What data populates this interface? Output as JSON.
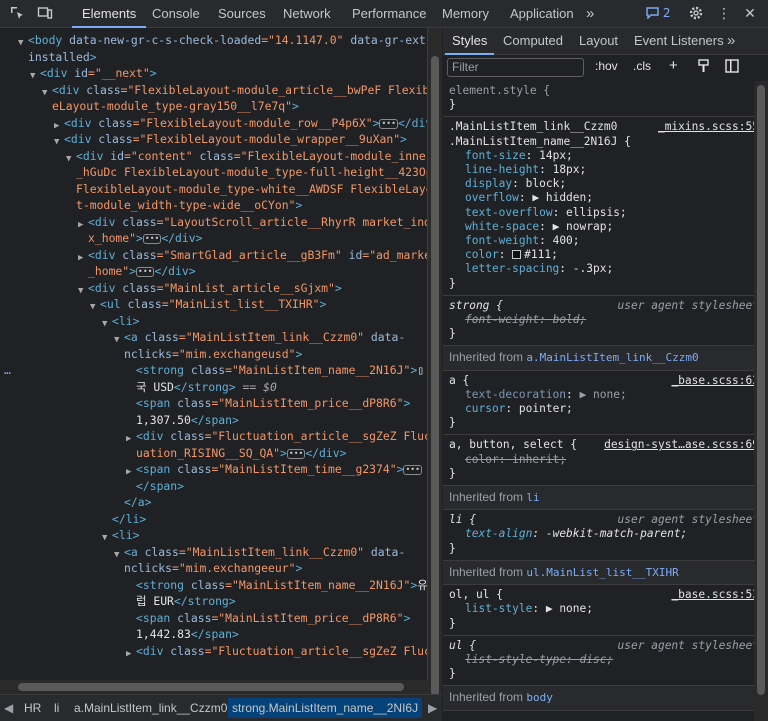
{
  "toolbar": {
    "tabs": [
      "Elements",
      "Console",
      "Sources",
      "Network",
      "Performance",
      "Memory",
      "Application"
    ],
    "active_tab": "Elements",
    "more": "»",
    "issues_count": "2",
    "icons": [
      "inspect-icon",
      "device-toggle-icon",
      "more-tabs-icon",
      "issues-icon",
      "gear-icon",
      "kebab-menu-icon",
      "close-icon"
    ]
  },
  "dom": {
    "selected_marker": "…",
    "lines": [
      [
        "<body ",
        "data-new-gr-c-s-check-loaded",
        "=\"14.1147.0\" ",
        "data-gr-ext-"
      ],
      [
        "installed",
        ">"
      ],
      [
        "<div ",
        "id",
        "=\"__next\"",
        ">"
      ],
      [
        "<div ",
        "class",
        "=\"FlexibleLayout-module_article__bwPeF Flexibl"
      ],
      [
        "eLayout-module_type-gray150__l7e7q\"",
        ">"
      ],
      [
        "<div ",
        "class",
        "=\"FlexibleLayout-module_row__P4p6X\"",
        ">",
        "</div>"
      ],
      [
        "<div ",
        "class",
        "=\"FlexibleLayout-module_wrapper__9uXan\"",
        ">"
      ],
      [
        "<div ",
        "id",
        "=\"content\" ",
        "class",
        "=\"FlexibleLayout-module_inner_"
      ],
      [
        "_hGuDc FlexibleLayout-module_type-full-height__423Op"
      ],
      [
        "FlexibleLayout-module_type-white__AWDSF FlexibleLayou"
      ],
      [
        "t-module_width-type-wide__oCYon\"",
        ">"
      ],
      [
        "<div ",
        "class",
        "=\"LayoutScroll_article__RhyrR market_inde"
      ],
      [
        "x_home\"",
        ">",
        "</div>"
      ],
      [
        "<div ",
        "class",
        "=\"SmartGlad_article__gB3Fm\" ",
        "id",
        "=\"ad_market"
      ],
      [
        "_home\"",
        ">",
        "</div>"
      ],
      [
        "<div ",
        "class",
        "=\"MainList_article__sGjxm\"",
        ">"
      ],
      [
        "<ul ",
        "class",
        "=\"MainList_list__TXIHR\"",
        ">"
      ],
      [
        "<li>"
      ],
      [
        "<a ",
        "class",
        "=\"MainListItem_link__Czzm0\" ",
        "data-"
      ],
      [
        "nclicks",
        "=\"mim.exchangeusd\"",
        ">"
      ],
      [
        "<strong ",
        "class",
        "=\"MainListItem_name__2N16J\"",
        ">"
      ],
      [
        "국 ",
        "USD",
        "</strong>",
        " == $0"
      ],
      [
        "<span ",
        "class",
        "=\"MainListItem_price__dP8R6\"",
        ">"
      ],
      [
        "1,307.50",
        "</span>"
      ],
      [
        "<div ",
        "class",
        "=\"Fluctuation_article__sgZeZ Fluct"
      ],
      [
        "uation_RISING__SQ_QA\"",
        ">",
        "</div>"
      ],
      [
        "<span ",
        "class",
        "=\"MainListItem_time__g2374\"",
        ">"
      ],
      [
        "</span>"
      ],
      [
        "</a>"
      ],
      [
        "</li>"
      ],
      [
        "<li>"
      ],
      [
        "<a ",
        "class",
        "=\"MainListItem_link__Czzm0\" ",
        "data-"
      ],
      [
        "nclicks",
        "=\"mim.exchangeeur\"",
        ">"
      ],
      [
        "<strong ",
        "class",
        "=\"MainListItem_name__2N16J\"",
        ">"
      ],
      [
        "럽 ",
        "EUR",
        "</strong>"
      ],
      [
        "<span ",
        "class",
        "=\"MainListItem_price__dP8R6\"",
        ">"
      ],
      [
        "1,442.83",
        "</span>"
      ],
      [
        "<div ",
        "class",
        "=\"Fluctuation_article__sgZeZ Fluct"
      ]
    ]
  },
  "breadcrumbs": {
    "items": [
      "HR",
      "li",
      "a.MainListItem_link__Czzm0",
      "strong.MainListItem_name__2NI6J"
    ],
    "current": "strong.MainListItem_name__2NI6J"
  },
  "styles_panel": {
    "tabs": [
      "Styles",
      "Computed",
      "Layout",
      "Event Listeners"
    ],
    "active_tab": "Styles",
    "more": "»",
    "filter_placeholder": "Filter",
    "hov": ":hov",
    "cls": ".cls",
    "rules": {
      "element_style": "element.style {",
      "r1_sel1": ".MainListItem_link__Czzm0",
      "r1_sel2": ".MainListItem_name__2N16J {",
      "r1_src": "_mixins.scss:55",
      "r1_props": [
        [
          "font-size",
          "14px;"
        ],
        [
          "line-height",
          "18px;"
        ],
        [
          "display",
          "block;"
        ],
        [
          "overflow",
          "▶ hidden;"
        ],
        [
          "text-overflow",
          "ellipsis;"
        ],
        [
          "white-space",
          "▶ nowrap;"
        ],
        [
          "font-weight",
          "400;"
        ],
        [
          "color",
          "#111;"
        ],
        [
          "letter-spacing",
          "-.3px;"
        ]
      ],
      "r2_sel": "strong {",
      "r2_src": "user agent stylesheet",
      "r2_prop": [
        "font-weight",
        "bold;"
      ],
      "inh1_label": "Inherited from",
      "inh1_link": "a.MainListItem_link__Czzm0",
      "r3_sel": "a {",
      "r3_src": "_base.scss:63",
      "r3_props": [
        [
          "text-decoration",
          "▶ none;"
        ],
        [
          "cursor",
          "pointer;"
        ]
      ],
      "r4_sel": "a, button, select {",
      "r4_src": "design-syst…ase.scss:69",
      "r4_prop": [
        "color",
        "inherit;"
      ],
      "inh2_label": "Inherited from",
      "inh2_link": "li",
      "r5_sel": "li {",
      "r5_src": "user agent stylesheet",
      "r5_prop": [
        "text-align",
        "-webkit-match-parent;"
      ],
      "inh3_label": "Inherited from",
      "inh3_link": "ul.MainList_list__TXIHR",
      "r6_sel": "ol, ul {",
      "r6_src": "_base.scss:53",
      "r6_prop": [
        "list-style",
        "▶ none;"
      ],
      "r7_sel": "ul {",
      "r7_src": "user agent stylesheet",
      "r7_prop": [
        "list-style-type",
        "disc;"
      ],
      "inh4_label": "Inherited from",
      "inh4_link": "body"
    }
  },
  "colors": {
    "accent": "#7cacf8",
    "selection": "#06427a",
    "tag": "#5db0d7",
    "attr_value": "#f29766"
  }
}
